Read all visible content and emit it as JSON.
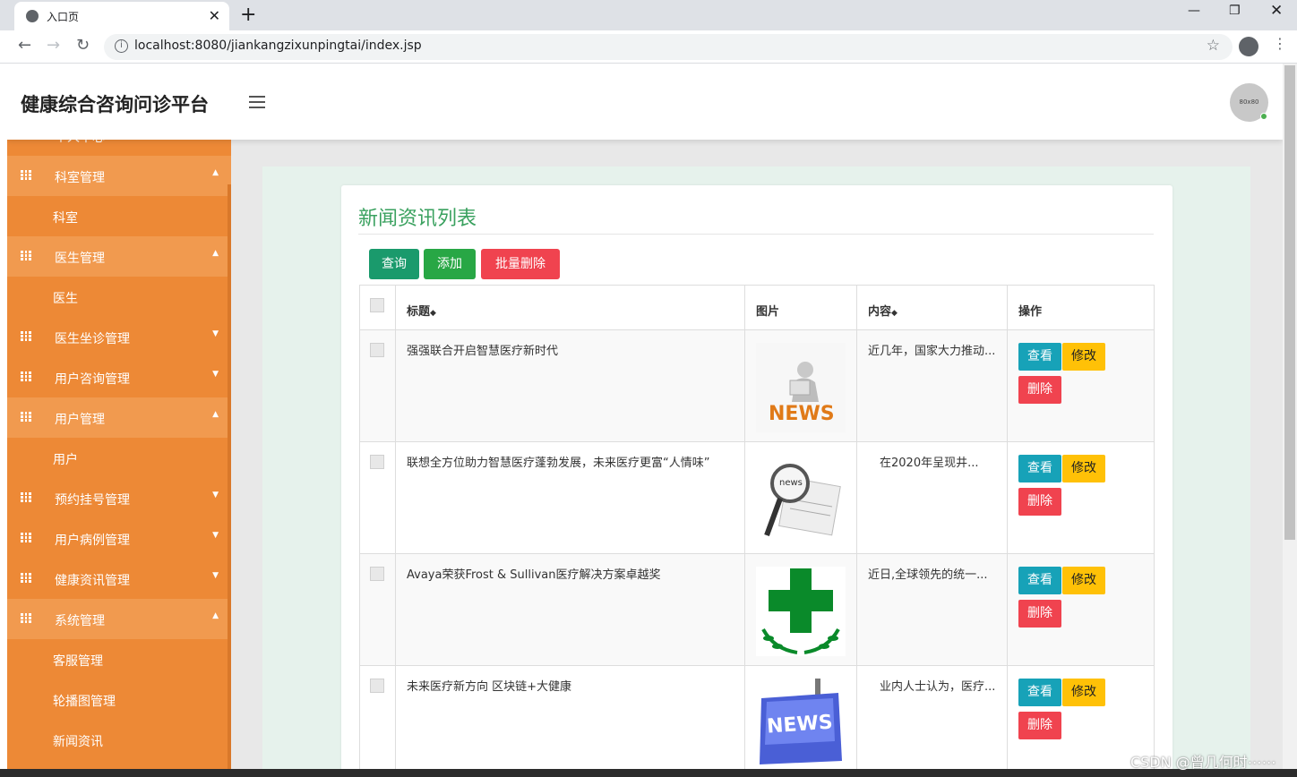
{
  "browser": {
    "tab_title": "入口页",
    "url": "localhost:8080/jiankangzixunpingtai/index.jsp"
  },
  "app": {
    "brand": "健康综合咨询问诊平台",
    "avatar_text": "80x80"
  },
  "sidebar": {
    "items": [
      {
        "label": "个人中心",
        "caret": "▼",
        "open": false
      },
      {
        "label": "科室管理",
        "caret": "▲",
        "open": true,
        "sub": [
          "科室"
        ]
      },
      {
        "label": "医生管理",
        "caret": "▲",
        "open": true,
        "sub": [
          "医生"
        ]
      },
      {
        "label": "医生坐诊管理",
        "caret": "▼",
        "open": false
      },
      {
        "label": "用户咨询管理",
        "caret": "▼",
        "open": false
      },
      {
        "label": "用户管理",
        "caret": "▲",
        "open": true,
        "sub": [
          "用户"
        ]
      },
      {
        "label": "预约挂号管理",
        "caret": "▼",
        "open": false
      },
      {
        "label": "用户病例管理",
        "caret": "▼",
        "open": false
      },
      {
        "label": "健康资讯管理",
        "caret": "▼",
        "open": false
      },
      {
        "label": "系统管理",
        "caret": "▲",
        "open": true,
        "sub": [
          "客服管理",
          "轮播图管理",
          "新闻资讯"
        ]
      }
    ]
  },
  "panel": {
    "title": "新闻资讯列表",
    "buttons": {
      "query": "查询",
      "add": "添加",
      "batch_delete": "批量删除"
    },
    "columns": {
      "title": "标题",
      "image": "图片",
      "content": "内容",
      "actions": "操作",
      "sort_icon": "◆"
    },
    "actions": {
      "view": "查看",
      "edit": "修改",
      "delete": "删除"
    },
    "rows": [
      {
        "title": "强强联合开启智慧医疗新时代",
        "image": "news-figure-image",
        "content": "近几年，国家大力推动..."
      },
      {
        "title": "联想全方位助力智慧医疗蓬勃发展，未来医疗更富“人情味”",
        "image": "magnifier-newspaper-image",
        "content": "　在2020年呈现井..."
      },
      {
        "title": "Avaya荣获Frost & Sullivan医疗解决方案卓越奖",
        "image": "green-cross-image",
        "content": "近日,全球领先的统一..."
      },
      {
        "title": "未来医疗新方向 区块链+大健康",
        "image": "news-key-image",
        "content": "　业内人士认为，医疗..."
      }
    ]
  },
  "watermark": "CSDN @曾几何时⋯⋯",
  "colors": {
    "sidebar": "#ed8936",
    "sidebar_open": "#f19a4f",
    "title_green": "#3aa15f",
    "query_btn": "#1a9a6c",
    "add_btn": "#28a745",
    "delete_btn": "#f0434f",
    "view_btn": "#17a2b8",
    "edit_btn": "#ffc107"
  }
}
